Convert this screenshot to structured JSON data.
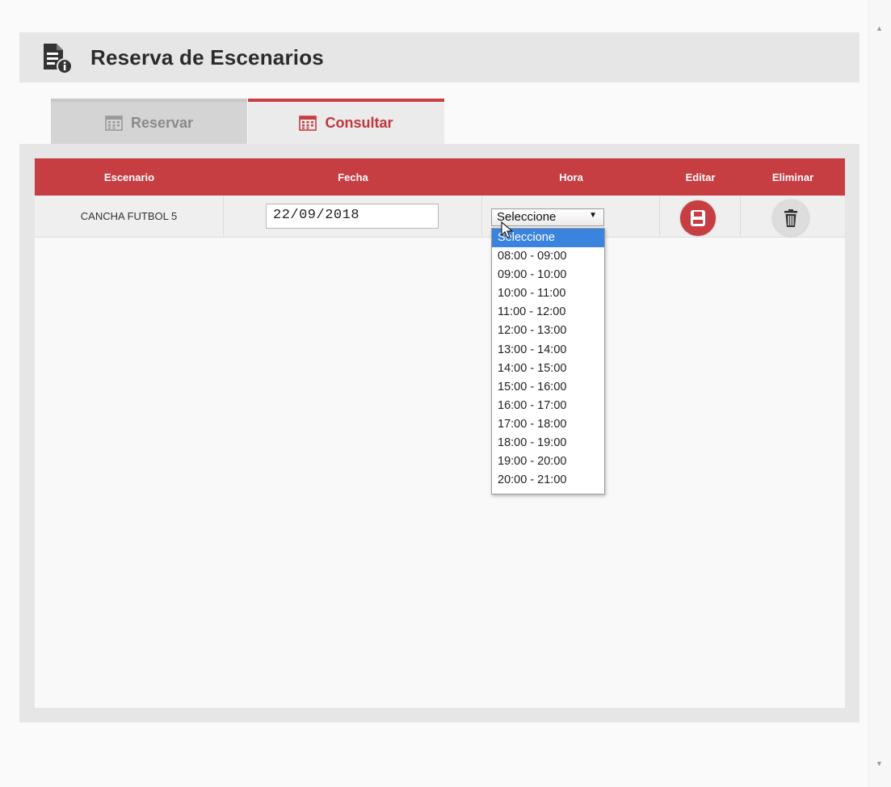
{
  "header": {
    "title": "Reserva de Escenarios",
    "icon": "document-info-icon"
  },
  "tabs": [
    {
      "label": "Reservar",
      "icon": "calendar-icon",
      "active": false
    },
    {
      "label": "Consultar",
      "icon": "calendar-icon",
      "active": true
    }
  ],
  "colors": {
    "accent": "#c63d42",
    "selected_option": "#3a84de",
    "panel": "#e6e6e6"
  },
  "table": {
    "columns": [
      "Escenario",
      "Fecha",
      "Hora",
      "Editar",
      "Eliminar"
    ],
    "rows": [
      {
        "escenario": "CANCHA FUTBOL 5",
        "fecha": "22/09/2018",
        "hora": "Seleccione",
        "edit_icon": "save-icon",
        "delete_icon": "trash-icon"
      }
    ]
  },
  "hora_dropdown": {
    "open": true,
    "highlighted": "Seleccione",
    "options": [
      "Seleccione",
      "08:00 - 09:00",
      "09:00 - 10:00",
      "10:00 - 11:00",
      "11:00 - 12:00",
      "12:00 - 13:00",
      "13:00 - 14:00",
      "14:00 - 15:00",
      "15:00 - 16:00",
      "16:00 - 17:00",
      "17:00 - 18:00",
      "18:00 - 19:00",
      "19:00 - 20:00",
      "20:00 - 21:00"
    ]
  }
}
